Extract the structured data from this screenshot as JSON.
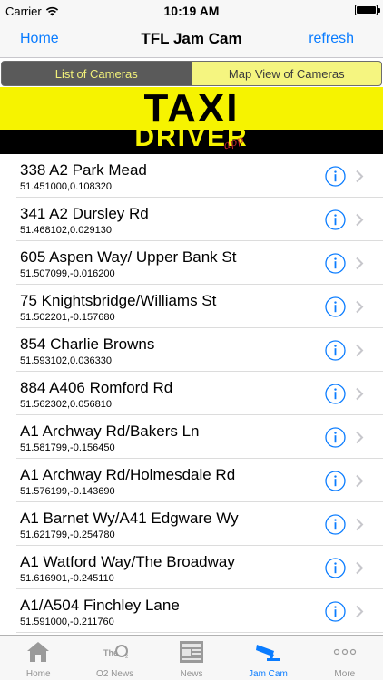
{
  "status_bar": {
    "carrier": "Carrier",
    "time": "10:19 AM"
  },
  "nav": {
    "left_label": "Home",
    "title": "TFL Jam Cam",
    "right_label": "refresh"
  },
  "segments": [
    {
      "label": "List of Cameras",
      "selected": true
    },
    {
      "label": "Map View of Cameras",
      "selected": false
    }
  ],
  "banner": {
    "line1": "TAXI",
    "line2": "DRIVER",
    "tag": "app"
  },
  "cameras": [
    {
      "title": "338 A2 Park Mead",
      "coords": "51.451000,0.108320"
    },
    {
      "title": "341 A2 Dursley Rd",
      "coords": "51.468102,0.029130"
    },
    {
      "title": "605 Aspen Way/ Upper Bank St",
      "coords": "51.507099,-0.016200"
    },
    {
      "title": "75 Knightsbridge/Williams St",
      "coords": "51.502201,-0.157680"
    },
    {
      "title": "854 Charlie Browns",
      "coords": "51.593102,0.036330"
    },
    {
      "title": "884 A406 Romford Rd",
      "coords": "51.562302,0.056810"
    },
    {
      "title": "A1 Archway Rd/Bakers Ln",
      "coords": "51.581799,-0.156450"
    },
    {
      "title": "A1 Archway Rd/Holmesdale Rd",
      "coords": "51.576199,-0.143690"
    },
    {
      "title": "A1 Barnet Wy/A41 Edgware Wy",
      "coords": "51.621799,-0.254780"
    },
    {
      "title": "A1 Watford Way/The Broadway",
      "coords": "51.616901,-0.245110"
    },
    {
      "title": "A1/A504 Finchley Lane",
      "coords": "51.591000,-0.211760"
    }
  ],
  "tabs": [
    {
      "label": "Home",
      "icon": "house-icon",
      "active": false
    },
    {
      "label": "O2 News",
      "icon": "o2-logo-icon",
      "active": false
    },
    {
      "label": "News",
      "icon": "newspaper-icon",
      "active": false
    },
    {
      "label": "Jam Cam",
      "icon": "cctv-camera-icon",
      "active": true
    },
    {
      "label": "More",
      "icon": "more-dots-icon",
      "active": false
    }
  ],
  "colors": {
    "accent": "#0a7cff",
    "banner_yellow": "#f6f300",
    "segment_dark": "#5a5a5a",
    "segment_light": "#f5f580",
    "tab_inactive": "#929292"
  }
}
